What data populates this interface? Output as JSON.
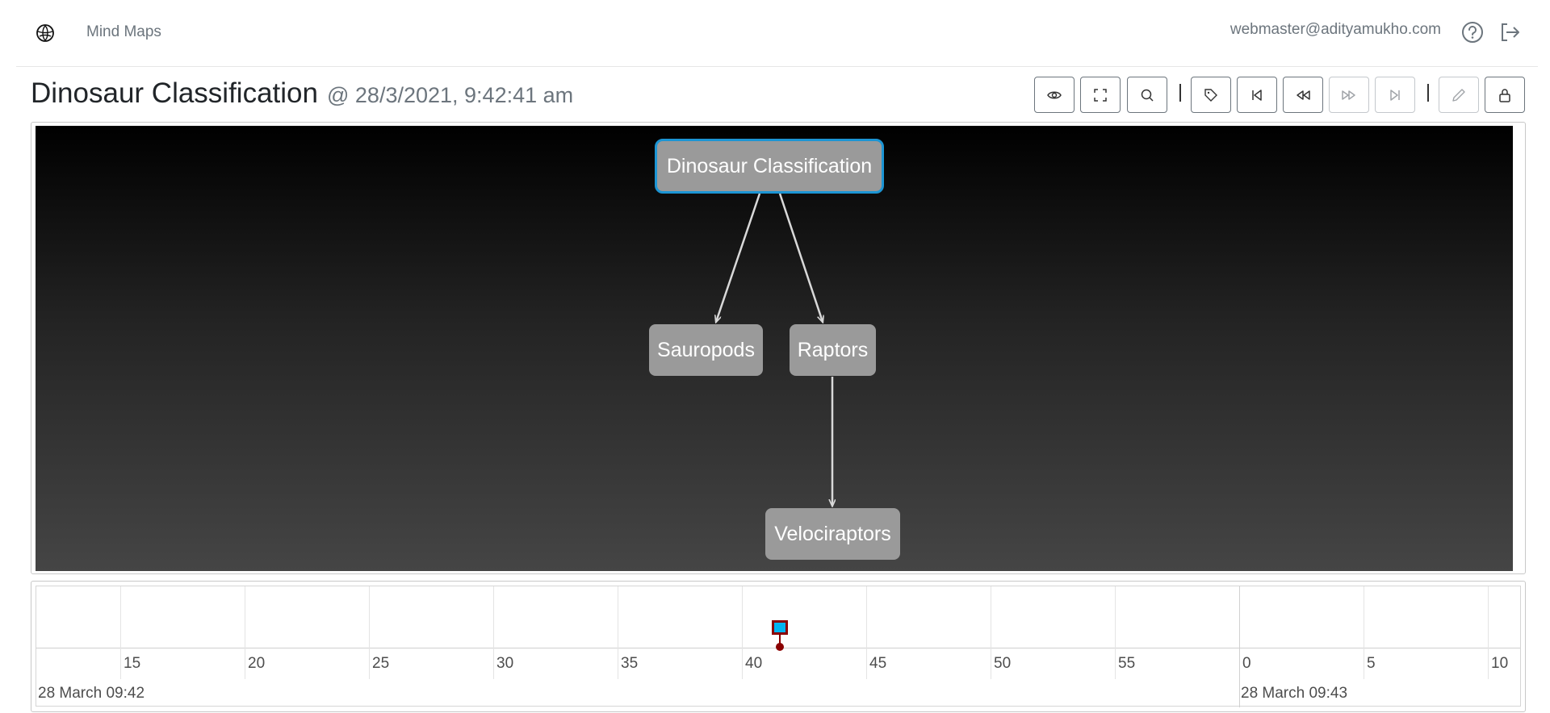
{
  "nav": {
    "brand": "Mind Maps",
    "user_email": "webmaster@adityamukho.com",
    "icons": {
      "brand": "brain-icon",
      "help": "help-circle-icon",
      "logout": "logout-icon"
    }
  },
  "page": {
    "title": "Dinosaur Classification",
    "timestamp": "@ 28/3/2021, 9:42:41 am"
  },
  "toolbar": {
    "buttons": [
      {
        "name": "view",
        "icon": "eye-icon",
        "disabled": false
      },
      {
        "name": "fullscreen",
        "icon": "expand-icon",
        "disabled": false
      },
      {
        "name": "search",
        "icon": "search-icon",
        "disabled": false
      },
      {
        "name": "tag",
        "icon": "tag-icon",
        "disabled": false
      },
      {
        "name": "first",
        "icon": "skip-back-icon",
        "disabled": false
      },
      {
        "name": "previous",
        "icon": "rewind-icon",
        "disabled": false
      },
      {
        "name": "next",
        "icon": "fast-forward-icon",
        "disabled": true
      },
      {
        "name": "last",
        "icon": "skip-forward-icon",
        "disabled": true
      },
      {
        "name": "edit",
        "icon": "pencil-icon",
        "disabled": true
      },
      {
        "name": "lock",
        "icon": "lock-icon",
        "disabled": false
      }
    ]
  },
  "graph": {
    "nodes": [
      {
        "id": "root",
        "label": "Dinosaur Classification",
        "selected": true
      },
      {
        "id": "sauropods",
        "label": "Sauropods"
      },
      {
        "id": "raptors",
        "label": "Raptors"
      },
      {
        "id": "velociraptors",
        "label": "Velociraptors"
      }
    ],
    "edges": [
      {
        "from": "root",
        "to": "sauropods"
      },
      {
        "from": "root",
        "to": "raptors"
      },
      {
        "from": "raptors",
        "to": "velociraptors"
      }
    ],
    "colors": {
      "node": "#9a9a9a",
      "selected_border": "#1c95d4",
      "edge": "#d9d9d9"
    }
  },
  "timeline": {
    "minor_ticks": [
      "15",
      "20",
      "25",
      "30",
      "35",
      "40",
      "45",
      "50",
      "55",
      "0",
      "5",
      "10"
    ],
    "major_labels": [
      "28 March 09:42",
      "28 March 09:43"
    ],
    "event": {
      "label": "",
      "color": "#00b4f0",
      "border": "#8b0000"
    }
  }
}
